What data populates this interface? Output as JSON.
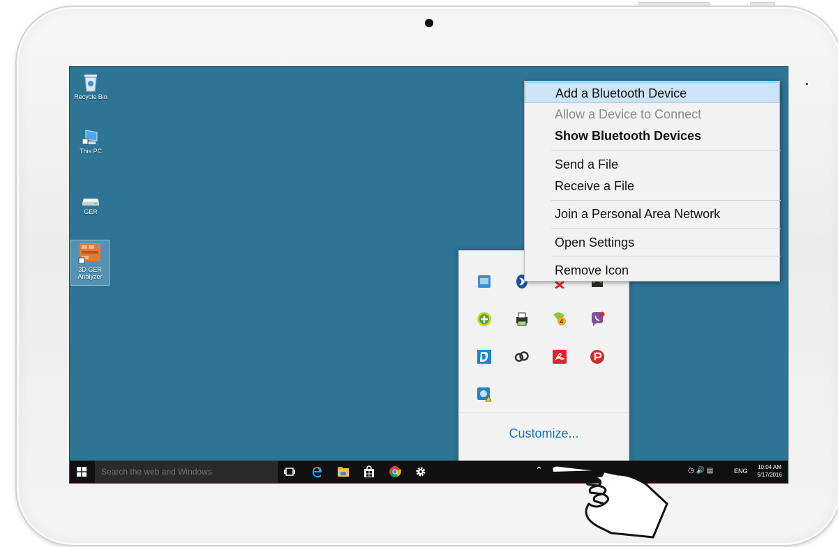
{
  "desktop": {
    "icons": [
      {
        "label": "Recycle Bin",
        "icon": "recycle-bin-icon"
      },
      {
        "label": "This PC",
        "icon": "computer-icon"
      },
      {
        "label": "GER",
        "icon": "drive-icon"
      },
      {
        "label": "3D GER Analyzer",
        "icon": "app-shortcut-icon"
      }
    ],
    "background_color": "#2d7495"
  },
  "context_menu": {
    "items": [
      {
        "label": "Add a Bluetooth Device",
        "state": "hover"
      },
      {
        "label": "Allow a Device to Connect",
        "state": "disabled"
      },
      {
        "label": "Show Bluetooth Devices",
        "state": "default-bold"
      },
      {
        "label": "Send a File",
        "state": "normal"
      },
      {
        "label": "Receive a File",
        "state": "normal"
      },
      {
        "label": "Join a Personal Area Network",
        "state": "normal"
      },
      {
        "label": "Open Settings",
        "state": "normal"
      },
      {
        "label": "Remove Icon",
        "state": "normal"
      }
    ]
  },
  "tray_overflow": {
    "icons": [
      "intel-graphics-icon",
      "bluetooth-icon",
      "network-error-icon",
      "nvidia-icon",
      "update-plus-icon",
      "printer-icon",
      "chat-badge-icon",
      "viber-icon",
      "dolby-icon",
      "creative-cloud-icon",
      "acrobat-icon",
      "psiphon-icon",
      "security-warning-icon"
    ],
    "customize_label": "Customize..."
  },
  "taskbar": {
    "search_placeholder": "Search the web and Windows",
    "pinned": [
      "task-view-icon",
      "edge-icon",
      "file-explorer-icon",
      "store-icon",
      "chrome-icon",
      "settings-icon"
    ],
    "language": "ENG",
    "time": "10:04 AM",
    "date": "5/17/2016"
  },
  "colors": {
    "accent": "#1a6fbf",
    "menu_hover": "#cde4f7",
    "taskbar": "#101010"
  }
}
